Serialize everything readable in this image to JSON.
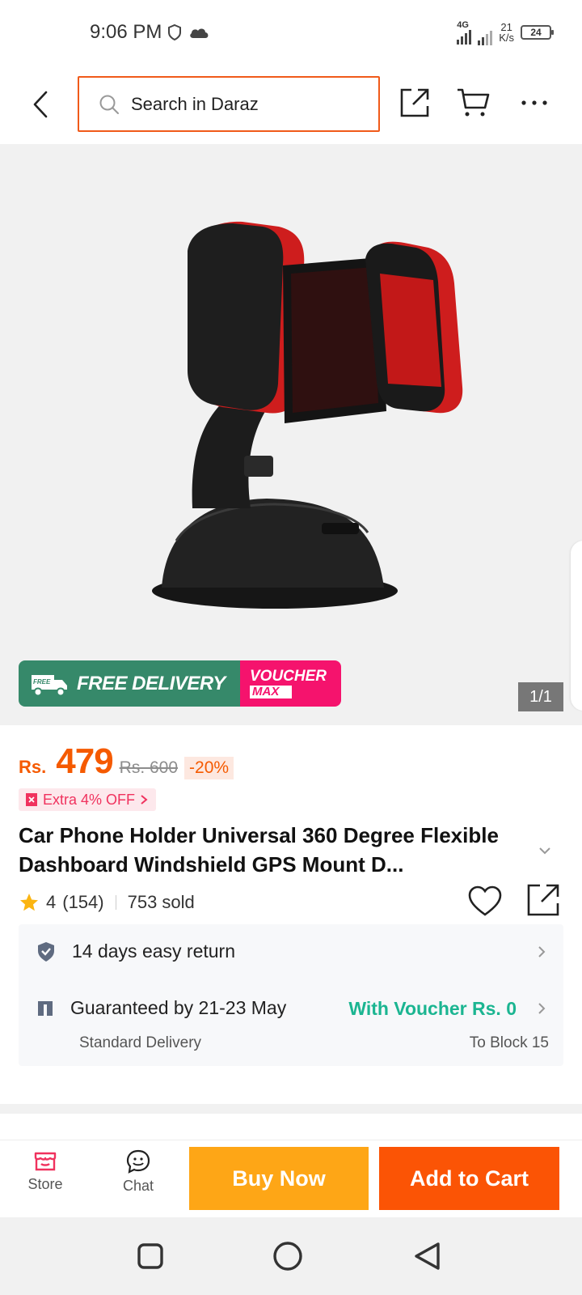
{
  "status_bar": {
    "time": "9:06 PM",
    "network": "4G",
    "speed_value": "21",
    "speed_unit": "K/s",
    "battery": "24"
  },
  "header": {
    "search_placeholder": "Search in Daraz",
    "icons": [
      "back-icon",
      "search-icon",
      "share-icon",
      "cart-icon",
      "more-icon"
    ]
  },
  "gallery": {
    "promo_left": "FREE DELIVERY",
    "promo_badge": "FREE",
    "promo_right_top": "VOUCHER",
    "promo_right_bottom": "MAX",
    "counter": "1/1"
  },
  "product": {
    "currency": "Rs.",
    "price": "479",
    "original_price": "Rs. 600",
    "discount": "-20%",
    "extra_offer": "Extra 4% OFF",
    "title": "Car Phone Holder Universal 360 Degree Flexible Dashboard Windshield GPS Mount D...",
    "rating": "4",
    "reviews": "(154)",
    "sold": "753 sold"
  },
  "delivery": {
    "return_policy": "14 days easy return",
    "guarantee": "Guaranteed by 21-23 May",
    "voucher": "With Voucher Rs. 0",
    "method": "Standard Delivery",
    "destination": "To Block 15"
  },
  "action_bar": {
    "store_label": "Store",
    "chat_label": "Chat",
    "buy_now": "Buy Now",
    "add_to_cart": "Add to Cart"
  },
  "colors": {
    "accent": "#f55a00",
    "buy_now": "#fea616",
    "add_to_cart": "#fb5405",
    "voucher_text": "#1bb591",
    "free_delivery": "#36896a",
    "voucher_max": "#f5136d"
  }
}
